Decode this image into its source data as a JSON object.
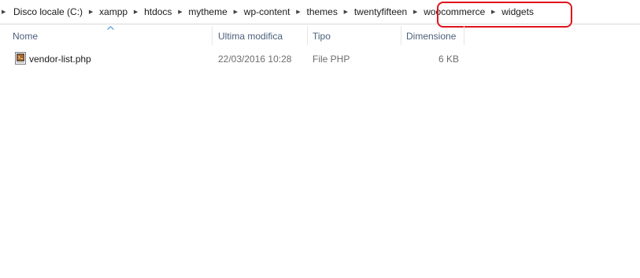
{
  "breadcrumb": {
    "items": [
      {
        "label": "Disco locale (C:)"
      },
      {
        "label": "xampp"
      },
      {
        "label": "htdocs"
      },
      {
        "label": "mytheme"
      },
      {
        "label": "wp-content"
      },
      {
        "label": "themes"
      },
      {
        "label": "twentyfifteen"
      },
      {
        "label": "woocommerce"
      },
      {
        "label": "widgets"
      }
    ]
  },
  "annotation": {
    "highlight_color": "#e0141e"
  },
  "columns": {
    "name": "Nome",
    "date": "Ultima modifica",
    "type": "Tipo",
    "size": "Dimensione",
    "sort_column": "name",
    "sort_direction": "ascending"
  },
  "files": [
    {
      "name": "vendor-list.php",
      "date": "22/03/2016 10:28",
      "type": "File PHP",
      "size": "6 KB",
      "icon": "php-file-icon"
    }
  ]
}
